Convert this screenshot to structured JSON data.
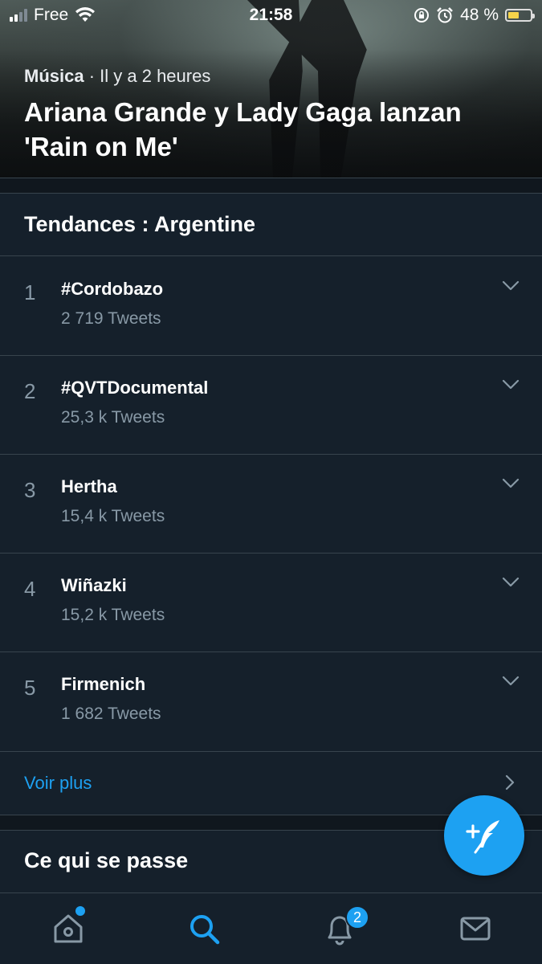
{
  "status_bar": {
    "carrier": "Free",
    "time": "21:58",
    "battery_percent": "48 %",
    "battery_level": 0.48,
    "battery_color": "#f6d44a"
  },
  "hero": {
    "category": "Música",
    "time_ago": " · Il y a 2 heures",
    "headline": "Ariana Grande y Lady Gaga lanzan 'Rain on Me'"
  },
  "trends": {
    "title": "Tendances : Argentine",
    "items": [
      {
        "rank": "1",
        "name": "#Cordobazo",
        "count": "2 719 Tweets"
      },
      {
        "rank": "2",
        "name": "#QVTDocumental",
        "count": "25,3 k Tweets"
      },
      {
        "rank": "3",
        "name": "Hertha",
        "count": "15,4 k Tweets"
      },
      {
        "rank": "4",
        "name": "Wiñazki",
        "count": "15,2 k Tweets"
      },
      {
        "rank": "5",
        "name": "Firmenich",
        "count": "1 682 Tweets"
      }
    ],
    "see_more": "Voir plus"
  },
  "happening": {
    "title": "Ce qui se passe"
  },
  "tab_bar": {
    "items": [
      "home-icon",
      "search-icon",
      "bell-icon",
      "mail-icon"
    ],
    "notifications_badge": "2",
    "active": "search-icon"
  },
  "colors": {
    "background": "#15202b",
    "accent": "#1da1f2",
    "secondary_text": "#8899a6",
    "divider": "#38444d"
  }
}
